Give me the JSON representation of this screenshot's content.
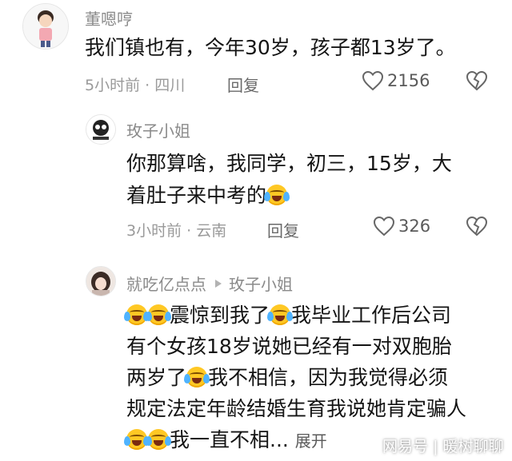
{
  "comments": [
    {
      "author": "董嗯哼",
      "text": "我们镇也有，今年30岁，孩子都13岁了。",
      "time": "5小时前",
      "location": "四川",
      "reply_label": "回复",
      "likes": "2156"
    },
    {
      "author": "玫子小姐",
      "text_line1": "你那算啥，我同学，初三，15岁，大",
      "text_line2": "着肚子来中考的",
      "time": "3小时前",
      "location": "云南",
      "reply_label": "回复",
      "likes": "326"
    },
    {
      "author": "就吃亿点点",
      "reply_to": "玫子小姐",
      "line1": "震惊到我了",
      "line1b": "我毕业工作后公司",
      "line2": "有个女孩18岁说她已经有一对双胞胎",
      "line3a": "两岁了",
      "line3b": "我不相信，因为我觉得必须",
      "line4": "规定法定年龄结婚生育我说她肯定骗人",
      "line5": "我一直不相... ",
      "expand_label": "展开"
    }
  ],
  "separator": "·",
  "watermark": {
    "brand": "网易号",
    "divider": "|",
    "account": "暖树聊聊"
  },
  "colors": {
    "like_icon": "#666666",
    "emoji": "#ffc824"
  },
  "icons": [
    "heart-outline-icon",
    "broken-heart-icon",
    "play-arrow-icon",
    "laughing-tears-emoji"
  ]
}
